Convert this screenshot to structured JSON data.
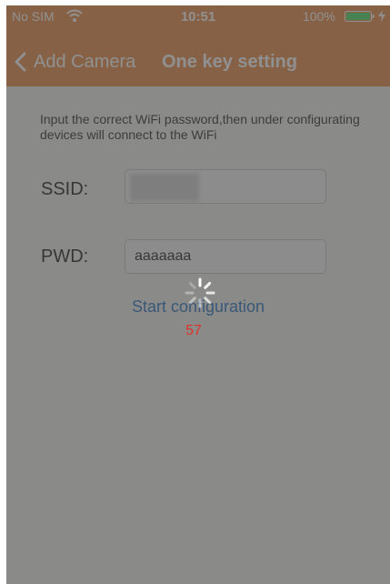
{
  "status_bar": {
    "carrier": "No SIM",
    "time": "10:51",
    "battery": "100%"
  },
  "nav": {
    "back_label": "Add Camera",
    "title": "One key setting"
  },
  "instruction": "Input the correct WiFi password,then under configurating devices will connect to the WiFi",
  "ssid": {
    "label": "SSID:",
    "value": ""
  },
  "pwd": {
    "label": "PWD:",
    "value": "aaaaaaa"
  },
  "start_button": "Start configuration",
  "countdown": "57",
  "colors": {
    "header": "#e98a46",
    "link": "#2a74c4",
    "countdown": "#e0332a",
    "battery": "#4cd964"
  },
  "icons": [
    "wifi-icon",
    "battery-icon",
    "charge-icon",
    "back-chevron-icon",
    "spinner-icon"
  ]
}
